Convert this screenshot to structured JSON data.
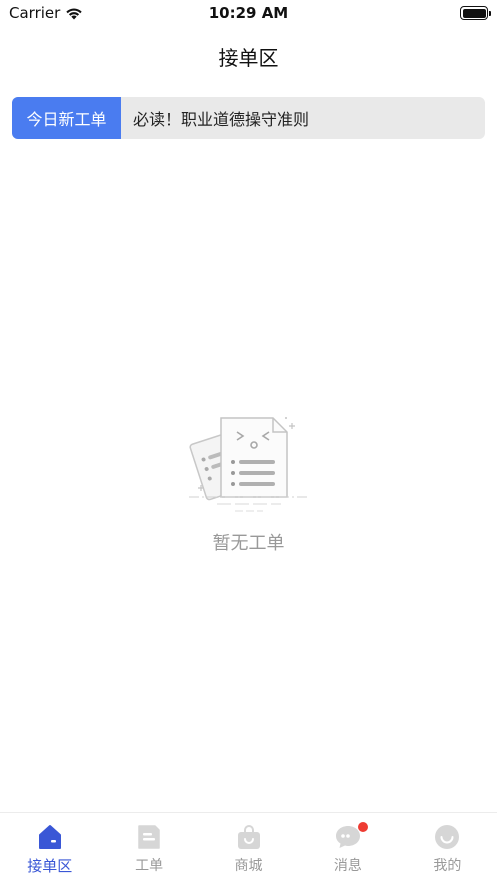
{
  "status_bar": {
    "carrier": "Carrier",
    "time": "10:29 AM",
    "icons": [
      "wifi-icon",
      "battery-icon"
    ]
  },
  "nav": {
    "title": "接单区"
  },
  "notice": {
    "tag": "今日新工单",
    "text": "必读！职业道德操守准则"
  },
  "empty_state": {
    "text": "暂无工单",
    "icon": "empty-document-illustration"
  },
  "tab_bar": {
    "active_color": "#3a57d6",
    "inactive_color": "#cccccc",
    "badge_color": "#ee3b32",
    "tabs": [
      {
        "label": "接单区",
        "icon": "home-icon",
        "active": true
      },
      {
        "label": "工单",
        "icon": "document-icon",
        "active": false
      },
      {
        "label": "商城",
        "icon": "shopping-bag-icon",
        "active": false
      },
      {
        "label": "消息",
        "icon": "chat-bubble-icon",
        "active": false,
        "badge": true
      },
      {
        "label": "我的",
        "icon": "smiley-icon",
        "active": false
      }
    ]
  }
}
